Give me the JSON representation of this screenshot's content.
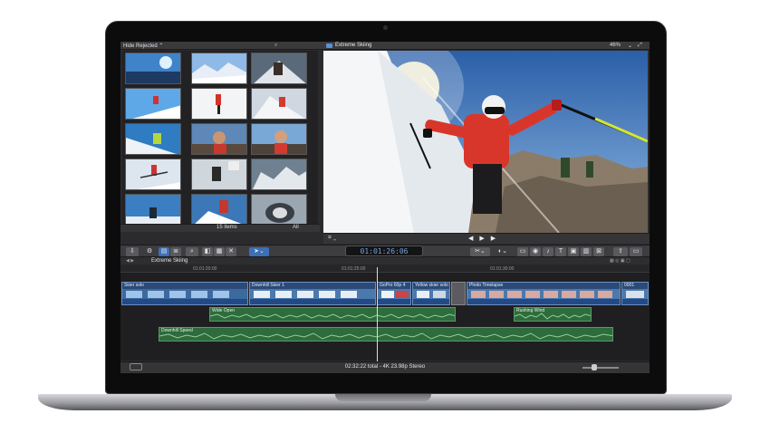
{
  "browser": {
    "filter_label": "Hide Rejected ⌃",
    "search_icon": "search-icon",
    "items_count": "15 items",
    "all_label": "All"
  },
  "viewer": {
    "title": "Extreme Skiing",
    "zoom": "46%",
    "menu_icon": "chevron-down-icon",
    "fullscreen_icon": "fullscreen-icon"
  },
  "toolbar": {
    "timecode": "01:01:26:06"
  },
  "timeline": {
    "title": "Extreme Skiing",
    "ruler": [
      "01:01:20:00",
      "01:01:25:00",
      "01:01:30:00"
    ],
    "clips": [
      {
        "label": "Skier solo"
      },
      {
        "label": "Downhill Skier 1"
      },
      {
        "label": "GoPro 60p 4"
      },
      {
        "label": "Yellow skier solo"
      },
      {
        "label": "Photo Timelapse"
      },
      {
        "label": "0001"
      }
    ],
    "audio": [
      {
        "label": "Wide Open"
      },
      {
        "label": "Rushing Wind"
      },
      {
        "label": "Downhill Speed"
      }
    ],
    "status": "02:32:22 total - 4K 23.98p Stereo"
  },
  "colors": {
    "video_clip": "#2c4a78",
    "audio_clip": "#2e6b3d",
    "timecode": "#7aa3d9"
  }
}
